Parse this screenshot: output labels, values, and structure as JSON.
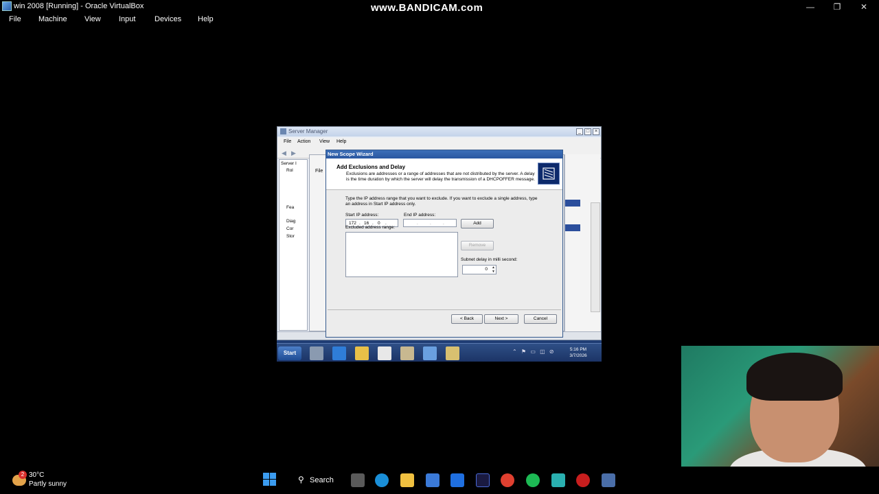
{
  "host": {
    "title": "win 2008 [Running] - Oracle VirtualBox",
    "watermark": "www.BANDICAM.com",
    "menu": [
      "File",
      "Machine",
      "View",
      "Input",
      "Devices",
      "Help"
    ],
    "controls": {
      "minimize": "—",
      "restore": "❐",
      "close": "✕"
    }
  },
  "server_manager": {
    "title": "Server Manager",
    "menu": [
      "File",
      "Action",
      "View",
      "Help"
    ],
    "tree": [
      "Server I",
      "Rol",
      "Fea",
      "Diag",
      "Cor",
      "Stor"
    ],
    "sub_menu": "File"
  },
  "wizard": {
    "title": "New Scope Wizard",
    "heading": "Add Exclusions and Delay",
    "description": "Exclusions are addresses or a range of addresses that are not distributed by the server. A delay is the time duration by which the server will delay the transmission of a DHCPOFFER message.",
    "instructions": "Type the IP address range that you want to exclude. If you want to exclude a single address, type an address in Start IP address only.",
    "start_ip_label": "Start IP address:",
    "start_ip": [
      "172",
      "16",
      "0",
      ""
    ],
    "end_ip_label": "End IP address:",
    "end_ip": [
      "",
      "",
      "",
      ""
    ],
    "add_button": "Add",
    "excluded_label": "Excluded address range:",
    "remove_button": "Remove",
    "subnet_delay_label": "Subnet delay in milli second:",
    "subnet_delay_value": "0",
    "back_button": "< Back",
    "next_button": "Next >",
    "cancel_button": "Cancel"
  },
  "vm_taskbar": {
    "start_label": "Start",
    "time": "5:16 PM",
    "date": "3/7/2026"
  },
  "win_taskbar": {
    "weather_badge": "2",
    "temperature": "30°C",
    "weather": "Partly sunny",
    "search_label": "Search"
  },
  "colors": {
    "accent": "#3b9cf0",
    "wizard_titlebar": "#2a57a0",
    "vm_desktop": "#1f3d74"
  }
}
